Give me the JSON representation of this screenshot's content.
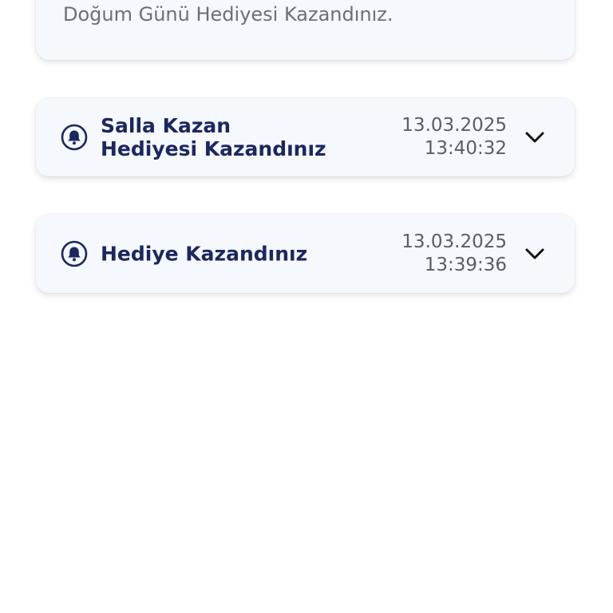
{
  "expanded_notification": {
    "body": "Doğum Günü Hediyesi Kazandınız."
  },
  "notifications": [
    {
      "title": "Salla Kazan\nHediyesi Kazandınız",
      "date": "13.03.2025",
      "time": "13:40:32",
      "icon": "bell-icon"
    },
    {
      "title": "Hediye Kazandınız",
      "date": "13.03.2025",
      "time": "13:39:36",
      "icon": "bell-icon"
    }
  ],
  "colors": {
    "title": "#1c2760",
    "body_text": "#6b6f78",
    "card_bg": "#f5f8fc",
    "icon": "#1c2760"
  }
}
